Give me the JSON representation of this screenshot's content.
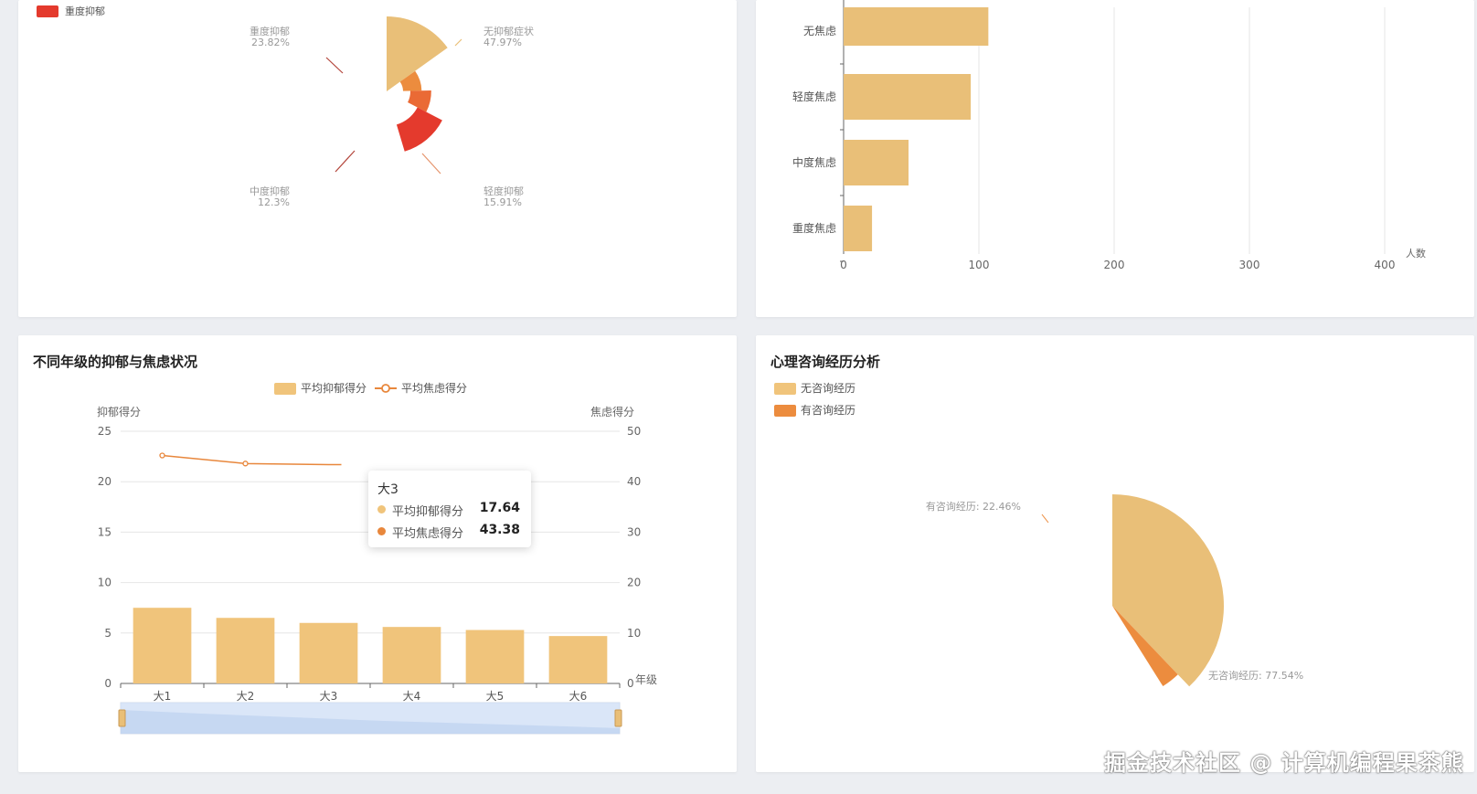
{
  "watermark": "掘金技术社区 @ 计算机编程果茶熊",
  "depression_rose": {
    "legend_top": "重度抑郁",
    "chart_data": {
      "type": "pie",
      "slices": [
        {
          "name": "无抑郁症状",
          "value": 47.97,
          "label_pct": "47.97%",
          "color": "#e9bf78"
        },
        {
          "name": "轻度抑郁",
          "value": 15.91,
          "label_pct": "15.91%",
          "color": "#ec8c3e"
        },
        {
          "name": "中度抑郁",
          "value": 12.3,
          "label_pct": "12.3%",
          "color": "#ea6a35"
        },
        {
          "name": "重度抑郁",
          "value": 23.82,
          "label_pct": "23.82%",
          "color": "#e43a2d"
        }
      ]
    }
  },
  "anxiety_bar": {
    "chart_data": {
      "type": "bar",
      "orientation": "horizontal",
      "categories": [
        "无焦虑",
        "轻度焦虑",
        "中度焦虑",
        "重度焦虑"
      ],
      "values": [
        107,
        94,
        48,
        21
      ],
      "xlim": [
        0,
        400
      ],
      "x_ticks": [
        "0",
        "100",
        "200",
        "300",
        "400"
      ],
      "xlabel": "人数",
      "color": "#e9bf78"
    }
  },
  "grade_chart": {
    "title": "不同年级的抑郁与焦虑状况",
    "legend": [
      "平均抑郁得分",
      "平均焦虑得分"
    ],
    "left_axis_name": "抑郁得分",
    "right_axis_name": "焦虑得分",
    "x_axis_name": "年级",
    "chart_data": {
      "type": "bar",
      "categories": [
        "大1",
        "大2",
        "大3",
        "大4",
        "大5",
        "大6"
      ],
      "series": [
        {
          "name": "平均抑郁得分",
          "type": "bar",
          "axis": "left",
          "values": [
            7.5,
            6.5,
            6.0,
            5.6,
            5.3,
            4.7
          ],
          "color": "#f0c47b"
        },
        {
          "name": "平均焦虑得分",
          "type": "line",
          "axis": "right",
          "values": [
            45.2,
            43.6,
            43.38
          ],
          "color": "#e8873c"
        }
      ],
      "ylim_left": [
        0,
        25
      ],
      "ylim_right": [
        0,
        50
      ],
      "left_ticks": [
        "0",
        "5",
        "10",
        "15",
        "20",
        "25"
      ],
      "right_ticks": [
        "0",
        "10",
        "20",
        "30",
        "40",
        "50"
      ]
    },
    "tooltip": {
      "title": "大3",
      "rows": [
        {
          "name": "平均抑郁得分",
          "value": "17.64",
          "color": "#f0c47b"
        },
        {
          "name": "平均焦虑得分",
          "value": "43.38",
          "color": "#e8873c"
        }
      ]
    }
  },
  "consult_chart": {
    "title": "心理咨询经历分析",
    "legend": [
      {
        "name": "无咨询经历",
        "color": "#f0c47b"
      },
      {
        "name": "有咨询经历",
        "color": "#ec8c3e"
      }
    ],
    "chart_data": {
      "type": "pie",
      "slices": [
        {
          "name": "无咨询经历",
          "value": 77.54,
          "label": "无咨询经历: 77.54%",
          "color": "#e9bf78"
        },
        {
          "name": "有咨询经历",
          "value": 22.46,
          "label": "有咨询经历: 22.46%",
          "color": "#ec8c3e"
        }
      ]
    }
  }
}
